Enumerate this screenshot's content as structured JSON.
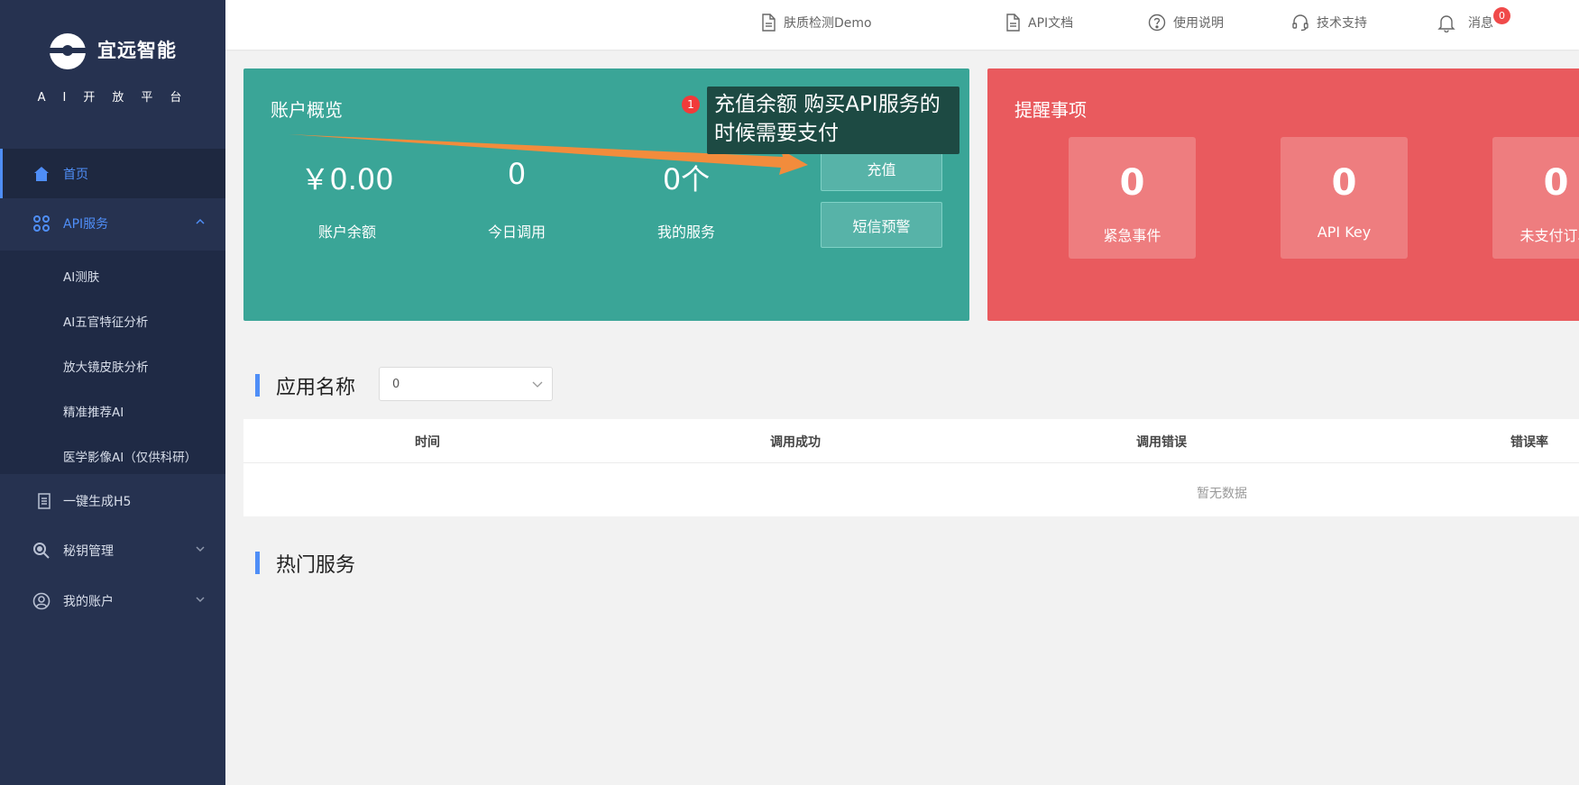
{
  "sidebar": {
    "brand_name": "宜远智能",
    "brand_sub": "AI开放平台",
    "items": [
      {
        "label": "首页",
        "icon": "home-icon",
        "active": true
      },
      {
        "label": "API服务",
        "icon": "apps-icon",
        "expanded": true
      },
      {
        "label": "一键生成H5",
        "icon": "document-icon"
      },
      {
        "label": "秘钥管理",
        "icon": "key-search-icon"
      },
      {
        "label": "我的账户",
        "icon": "user-icon"
      }
    ],
    "sub_items": [
      "AI测肤",
      "AI五官特征分析",
      "放大镜皮肤分析",
      "精准推荐AI",
      "医学影像AI（仅供科研）"
    ]
  },
  "topbar": {
    "links": [
      {
        "label": "肤质检测Demo",
        "icon": "file-icon"
      },
      {
        "label": "API文档",
        "icon": "file-icon"
      },
      {
        "label": "使用说明",
        "icon": "help-icon"
      },
      {
        "label": "技术支持",
        "icon": "headset-icon"
      },
      {
        "label": "消息",
        "icon": "bell-icon"
      }
    ],
    "message_count": "0"
  },
  "account": {
    "title": "账户概览",
    "stats": [
      {
        "value": "￥0.00",
        "label": "账户余额"
      },
      {
        "value": "0",
        "label": "今日调用"
      },
      {
        "value": "0个",
        "label": "我的服务"
      }
    ],
    "recharge_label": "充值",
    "sms_alert_label": "短信预警"
  },
  "tooltip": {
    "badge": "1",
    "text": "充值余额 购买API服务的时候需要支付"
  },
  "reminders": {
    "title": "提醒事项",
    "tiles": [
      {
        "value": "0",
        "label": "紧急事件"
      },
      {
        "value": "0",
        "label": "API Key"
      },
      {
        "value": "0",
        "label": "未支付订单"
      }
    ]
  },
  "app_section": {
    "title": "应用名称",
    "select_value": "0",
    "columns": [
      "时间",
      "调用成功",
      "调用错误",
      "错误率"
    ],
    "empty_text": "暂无数据"
  },
  "hot_section": {
    "title": "热门服务"
  },
  "colors": {
    "sidebar": "#263250",
    "accent": "#4f8ef7",
    "green_card": "#3aa597",
    "red_card": "#e95a5e",
    "arrow": "#f28c3c"
  }
}
